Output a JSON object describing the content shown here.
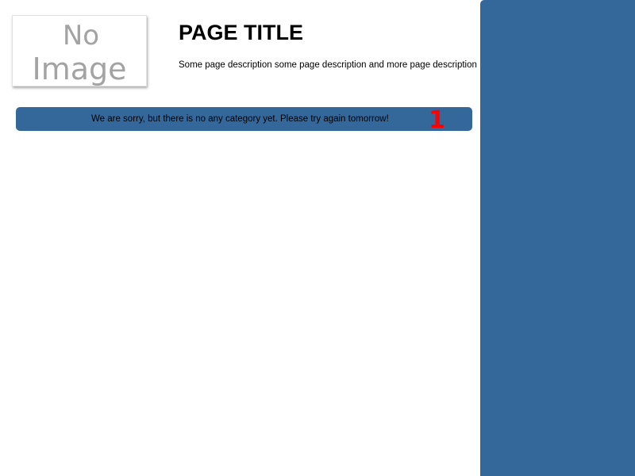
{
  "header": {
    "image_placeholder_text": "No Image",
    "title": "PAGE TITLE",
    "description": "Some page description some page description and more page description"
  },
  "notice": {
    "message": "We are sorry, but there is no any category yet. Please try again tomorrow!",
    "count": "1"
  },
  "colors": {
    "accent_blue": "#35689a",
    "count_red": "#ff0000"
  }
}
